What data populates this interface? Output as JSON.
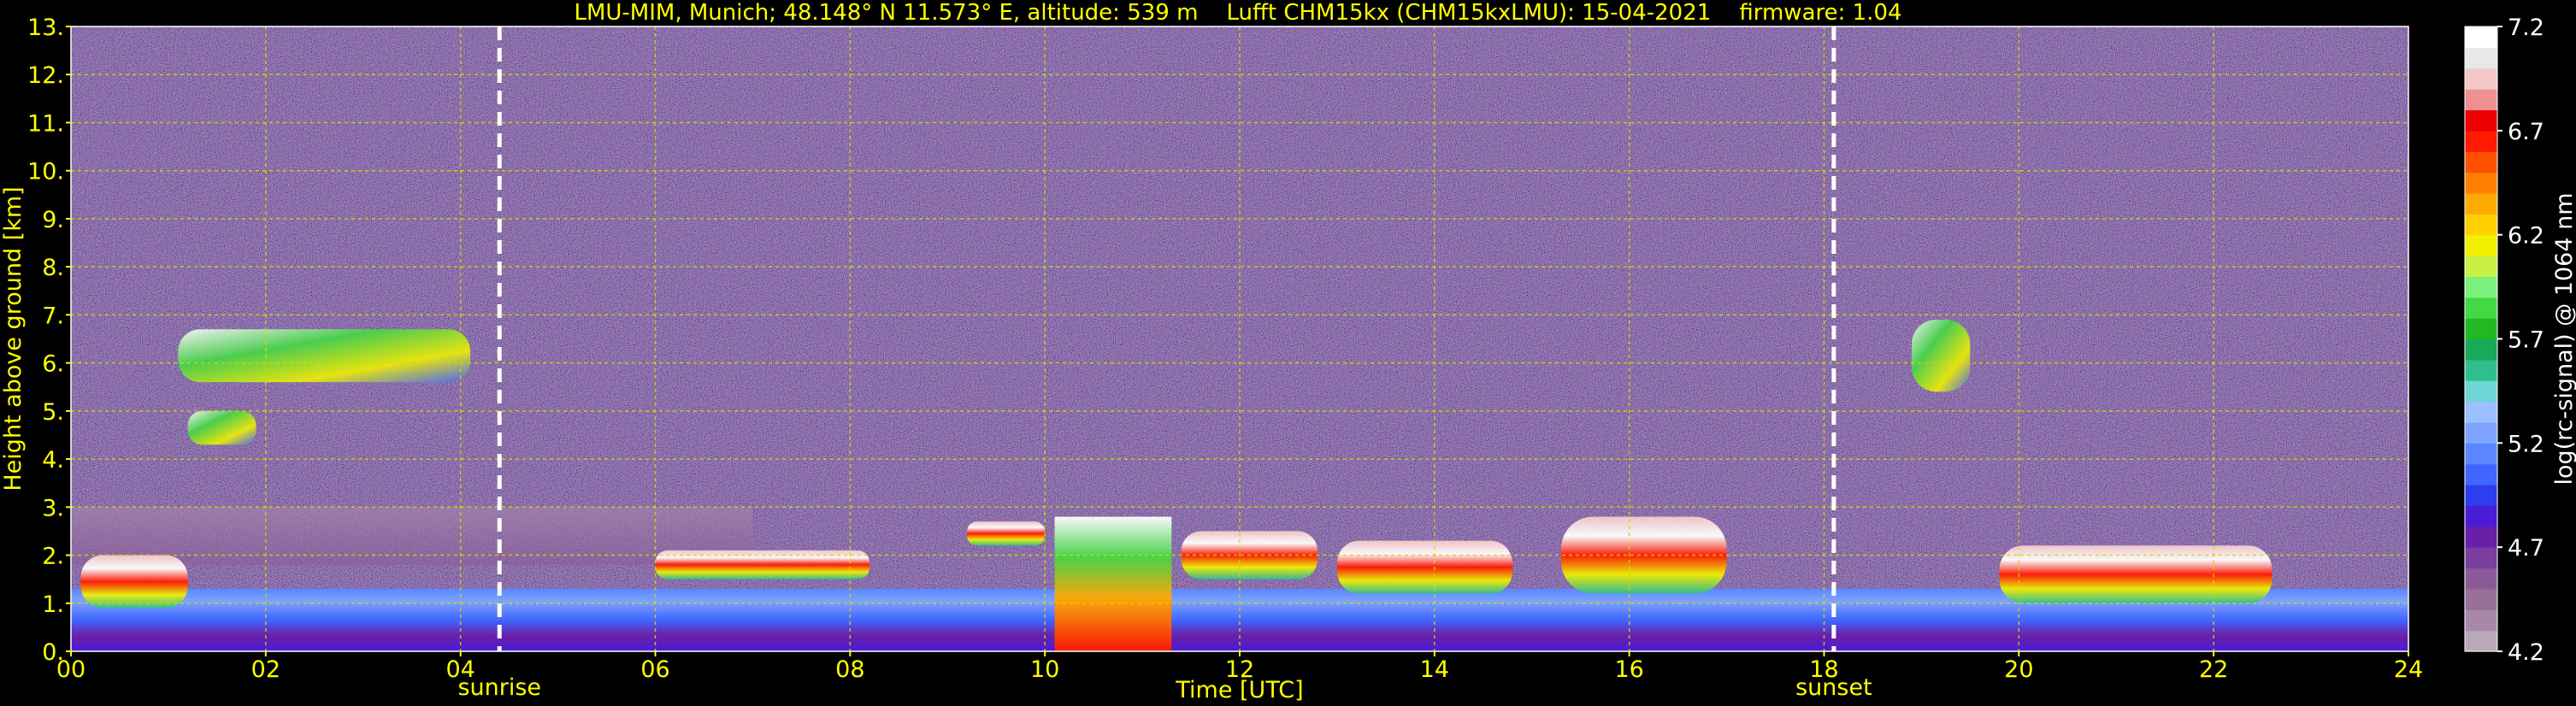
{
  "chart_data": {
    "type": "heatmap",
    "title": "LMU-MIM, Munich; 48.148° N 11.573° E, altitude: 539 m    Lufft CHM15kx (CHM15kxLMU): 15-04-2021    firmware: 1.04",
    "xlabel": "Time [UTC]",
    "ylabel": "Height above ground [km]",
    "xlim": [
      0,
      24
    ],
    "ylim": [
      0,
      13
    ],
    "x_ticks": [
      "00",
      "02",
      "04",
      "06",
      "08",
      "10",
      "12",
      "14",
      "16",
      "18",
      "20",
      "22",
      "24"
    ],
    "x_tick_values": [
      0,
      2,
      4,
      6,
      8,
      10,
      12,
      14,
      16,
      18,
      20,
      22,
      24
    ],
    "y_ticks": [
      "0.",
      "1.",
      "2.",
      "3.",
      "4.",
      "5.",
      "6.",
      "7.",
      "8.",
      "9.",
      "10.",
      "11.",
      "12.",
      "13."
    ],
    "y_tick_values": [
      0,
      1,
      2,
      3,
      4,
      5,
      6,
      7,
      8,
      9,
      10,
      11,
      12,
      13
    ],
    "grid": true,
    "annotations": [
      {
        "label": "sunrise",
        "x": 4.4
      },
      {
        "label": "sunset",
        "x": 18.1
      }
    ],
    "colorbar": {
      "label": "log(rc-signal) @ 1064 nm",
      "range": [
        4.2,
        7.2
      ],
      "ticks": [
        "4.2",
        "4.7",
        "5.2",
        "5.7",
        "6.2",
        "6.7",
        "7.2"
      ],
      "tick_values": [
        4.2,
        4.7,
        5.2,
        5.7,
        6.2,
        6.7,
        7.2
      ],
      "colors": [
        "#b8a8b8",
        "#a888a8",
        "#987098",
        "#8a5a96",
        "#7a3f9e",
        "#6a1fa8",
        "#4a1cd6",
        "#2e3df0",
        "#3f66ff",
        "#5a86ff",
        "#7ea4ff",
        "#9cc0ff",
        "#6fd6d6",
        "#2fbf8f",
        "#1aa85a",
        "#22b822",
        "#44d844",
        "#7cf07c",
        "#c8f046",
        "#f0f000",
        "#ffd000",
        "#ffaa00",
        "#ff8000",
        "#ff5000",
        "#ff1a00",
        "#ee0000",
        "#ee9090",
        "#f4c8c8",
        "#e8e8e8",
        "#ffffff"
      ]
    },
    "layers": [
      {
        "kind": "mixing-layer",
        "x": [
          0,
          24
        ],
        "height_km": [
          0,
          1.3
        ]
      },
      {
        "kind": "residual-layer",
        "x": [
          0,
          7
        ],
        "height_km": [
          1.8,
          3.0
        ]
      },
      {
        "kind": "cloud",
        "x": [
          0.1,
          1.2
        ],
        "height_km": [
          0.9,
          2.0
        ]
      },
      {
        "kind": "cloud",
        "x": [
          6.0,
          8.2
        ],
        "height_km": [
          1.5,
          2.1
        ]
      },
      {
        "kind": "cloud",
        "x": [
          9.2,
          10.0
        ],
        "height_km": [
          2.2,
          2.7
        ]
      },
      {
        "kind": "precipitation",
        "x": [
          10.1,
          11.3
        ],
        "height_km": [
          0,
          2.8
        ]
      },
      {
        "kind": "cloud",
        "x": [
          11.4,
          12.8
        ],
        "height_km": [
          1.5,
          2.5
        ]
      },
      {
        "kind": "cloud",
        "x": [
          13.0,
          14.8
        ],
        "height_km": [
          1.2,
          2.3
        ]
      },
      {
        "kind": "cloud",
        "x": [
          15.3,
          17.0
        ],
        "height_km": [
          1.2,
          2.8
        ]
      },
      {
        "kind": "cloud",
        "x": [
          19.8,
          22.6
        ],
        "height_km": [
          1.0,
          2.2
        ]
      },
      {
        "kind": "cirrus",
        "x": [
          1.1,
          4.1
        ],
        "height_km": [
          5.6,
          6.7
        ]
      },
      {
        "kind": "cirrus",
        "x": [
          1.2,
          1.9
        ],
        "height_km": [
          4.3,
          5.0
        ]
      },
      {
        "kind": "cirrus",
        "x": [
          18.9,
          19.5
        ],
        "height_km": [
          5.4,
          6.9
        ]
      }
    ]
  }
}
